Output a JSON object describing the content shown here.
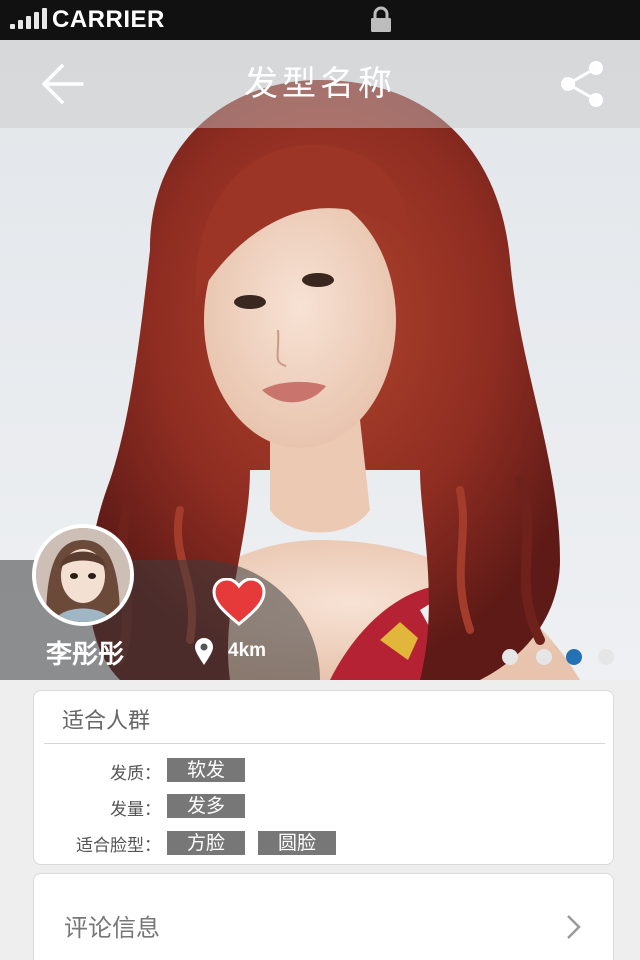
{
  "status_bar": {
    "carrier": "CARRIER",
    "signal_icon": "signal-bars-icon",
    "lock_icon": "lock-icon"
  },
  "nav": {
    "title": "发型名称",
    "back_icon": "arrow-left-icon",
    "share_icon": "share-icon"
  },
  "hero": {
    "author_name": "李彤彤",
    "like_icon": "heart-icon",
    "location_icon": "map-pin-icon",
    "distance": "4km",
    "carousel": {
      "total": 4,
      "active_index": 3
    }
  },
  "suitable": {
    "title": "适合人群",
    "attributes": [
      {
        "label": "发质：",
        "tags": [
          "软发"
        ]
      },
      {
        "label": "发量：",
        "tags": [
          "发多"
        ]
      },
      {
        "label": "适合脸型：",
        "tags": [
          "方脸",
          "圆脸"
        ]
      }
    ]
  },
  "comments": {
    "title": "评论信息",
    "chevron_icon": "chevron-right-icon"
  },
  "colors": {
    "accent": "#2372b5",
    "heart": "#e63a3a",
    "tag_bg": "#777777"
  }
}
